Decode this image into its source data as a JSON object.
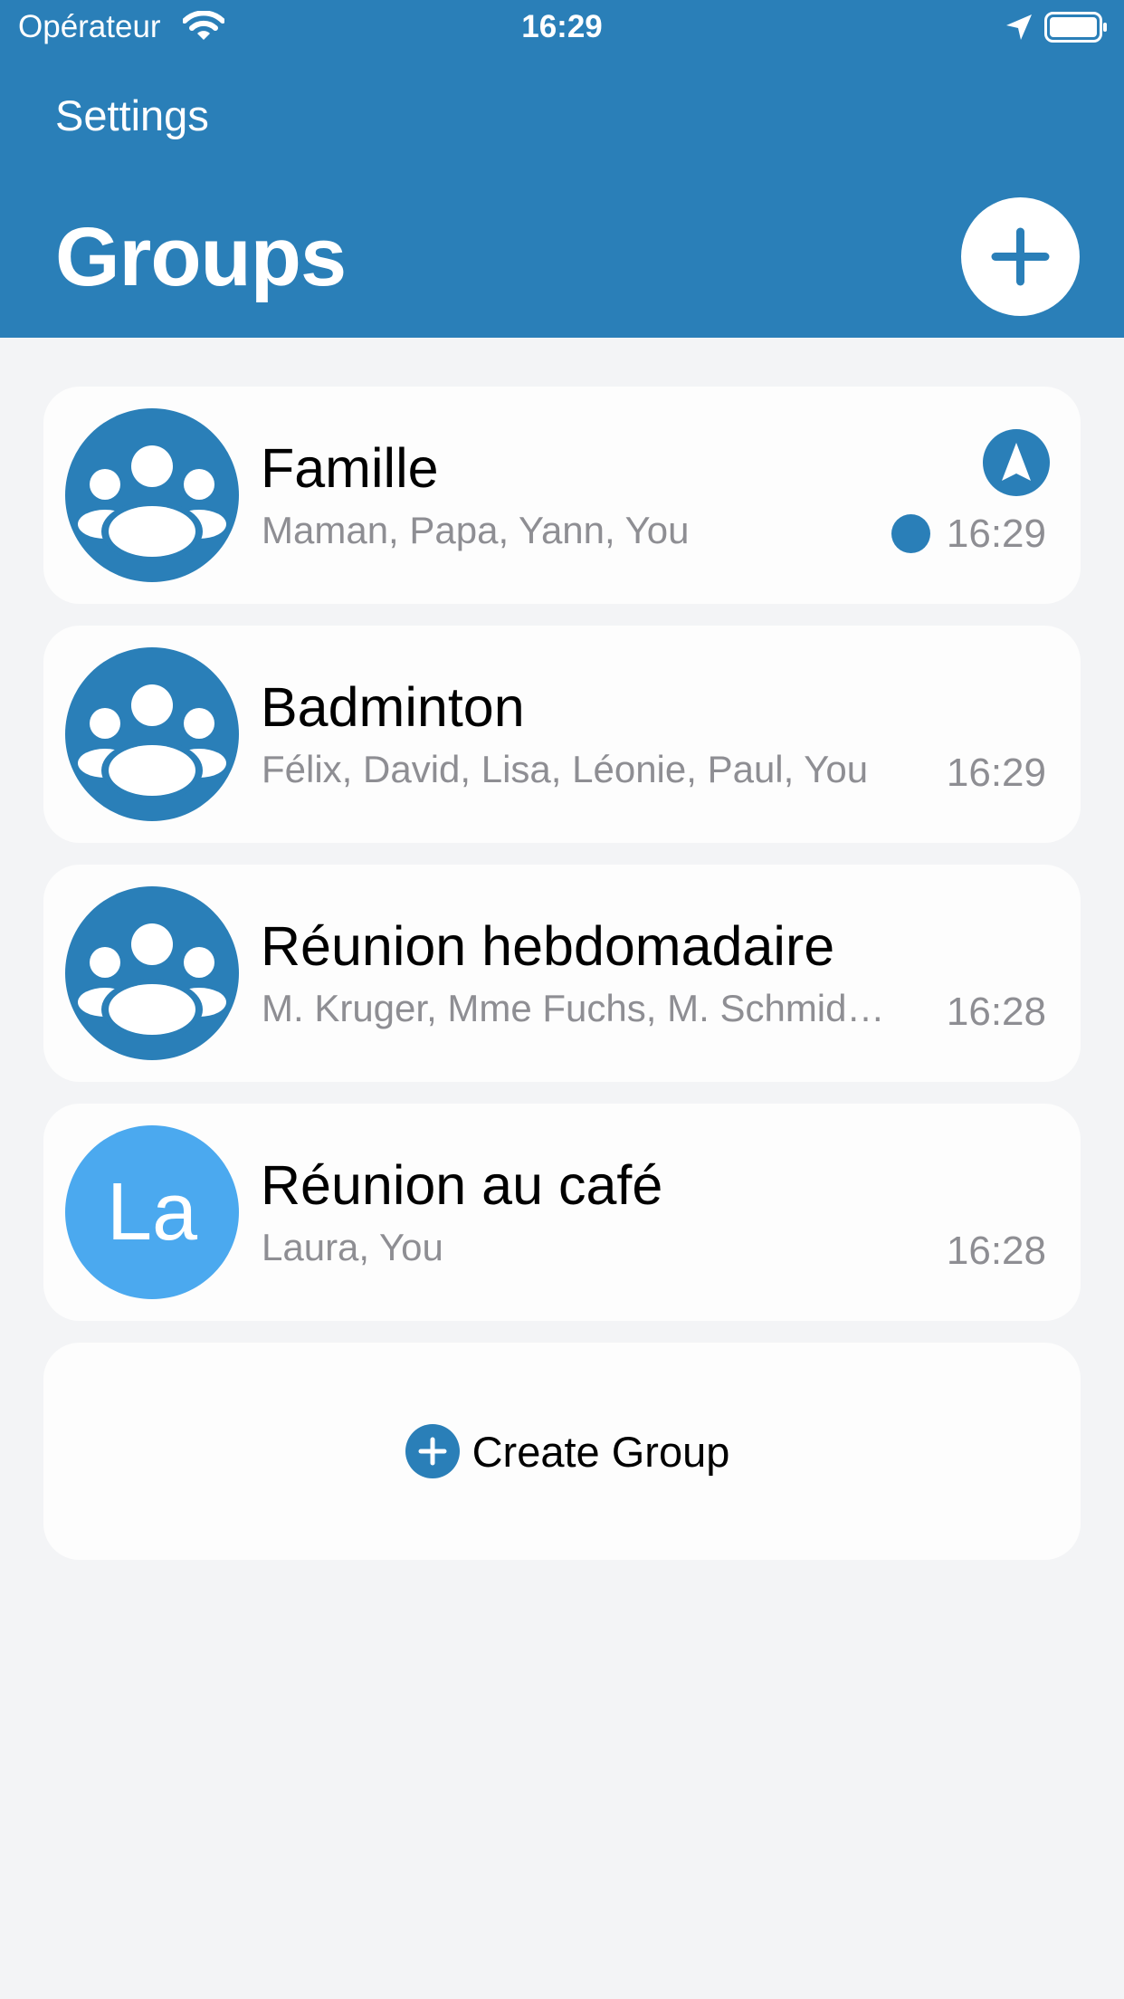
{
  "status_bar": {
    "carrier": "Opérateur",
    "time": "16:29",
    "icons": [
      "wifi-icon",
      "location-arrow-icon",
      "battery-icon"
    ]
  },
  "header": {
    "settings_label": "Settings",
    "title": "Groups",
    "add_icon": "plus-icon"
  },
  "groups": [
    {
      "name": "Famille",
      "members": "Maman, Papa, Yann, You",
      "time": "16:29",
      "avatar": "group-icon",
      "unread": true,
      "sharing_location": true
    },
    {
      "name": "Badminton",
      "members": "Félix, David, Lisa, Léonie, Paul, You",
      "time": "16:29",
      "avatar": "group-icon"
    },
    {
      "name": "Réunion hebdomadaire",
      "members": "M. Kruger, Mme Fuchs, M. Schmid…",
      "time": "16:28",
      "avatar": "group-icon"
    },
    {
      "name": "Réunion au café",
      "members": "Laura, You",
      "time": "16:28",
      "avatar_initials": "La"
    }
  ],
  "create_group": {
    "label": "Create Group",
    "icon": "plus-circle-icon"
  },
  "colors": {
    "primary": "#2A7FB8",
    "initials_avatar": "#4BA9EF",
    "background": "#F3F4F6",
    "card": "#FDFDFD",
    "secondary_text": "#8E8E93"
  }
}
